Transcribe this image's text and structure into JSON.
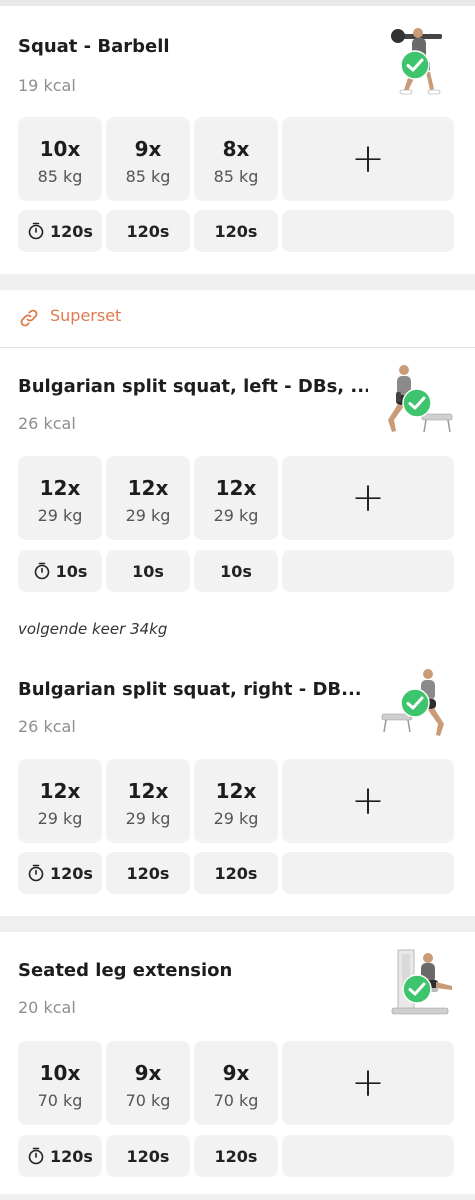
{
  "exercises": [
    {
      "title": "Squat - Barbell",
      "kcal": "19 kcal",
      "image": "squat-barbell-figure",
      "sets": [
        {
          "reps": "10x",
          "weight": "85 kg"
        },
        {
          "reps": "9x",
          "weight": "85 kg"
        },
        {
          "reps": "8x",
          "weight": "85 kg"
        }
      ],
      "rests": [
        "120s",
        "120s",
        "120s"
      ]
    },
    {
      "title": "Bulgarian split squat, left - DBs, ...",
      "kcal": "26 kcal",
      "image": "bulgarian-split-squat-left-figure",
      "sets": [
        {
          "reps": "12x",
          "weight": "29 kg"
        },
        {
          "reps": "12x",
          "weight": "29 kg"
        },
        {
          "reps": "12x",
          "weight": "29 kg"
        }
      ],
      "rests": [
        "10s",
        "10s",
        "10s"
      ],
      "note": "volgende keer 34kg"
    },
    {
      "title": "Bulgarian split squat, right - DB...",
      "kcal": "26 kcal",
      "image": "bulgarian-split-squat-right-figure",
      "sets": [
        {
          "reps": "12x",
          "weight": "29 kg"
        },
        {
          "reps": "12x",
          "weight": "29 kg"
        },
        {
          "reps": "12x",
          "weight": "29 kg"
        }
      ],
      "rests": [
        "120s",
        "120s",
        "120s"
      ]
    },
    {
      "title": "Seated leg extension",
      "kcal": "20 kcal",
      "image": "seated-leg-extension-figure",
      "sets": [
        {
          "reps": "10x",
          "weight": "70 kg"
        },
        {
          "reps": "9x",
          "weight": "70 kg"
        },
        {
          "reps": "9x",
          "weight": "70 kg"
        }
      ],
      "rests": [
        "120s",
        "120s",
        "120s"
      ]
    }
  ],
  "superset": {
    "label": "Superset",
    "icon": "link-icon"
  },
  "add_set": {
    "label": "+"
  },
  "icons": {
    "timer": "stopwatch-icon",
    "completed": "check-circle-icon"
  },
  "colors": {
    "accent": "#e07a4e",
    "check": "#3ec46d",
    "cell": "#f2f2f2",
    "background": "#efefef"
  }
}
